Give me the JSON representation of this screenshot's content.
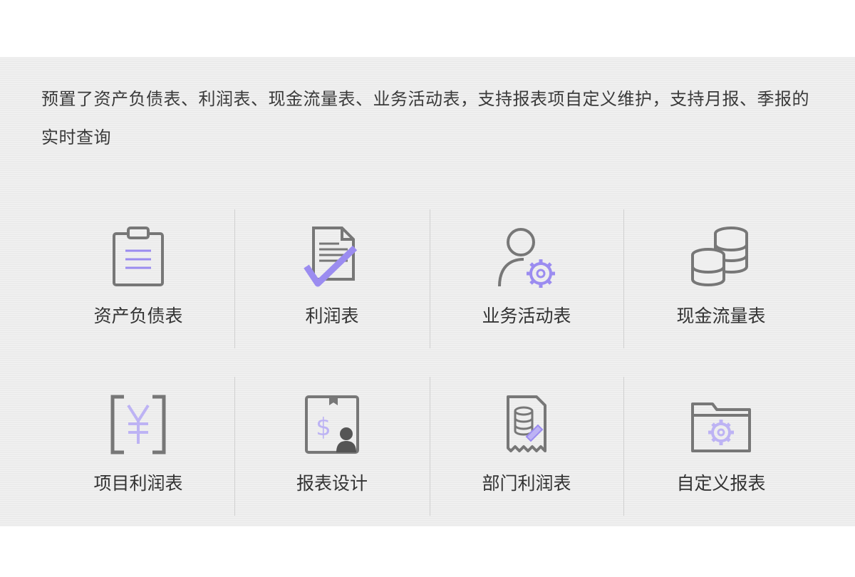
{
  "description": "预置了资产负债表、利润表、现金流量表、业务活动表，支持报表项自定义维护，支持月报、季报的实时查询",
  "tiles": [
    {
      "label": "资产负债表",
      "icon": "clipboard-icon"
    },
    {
      "label": "利润表",
      "icon": "document-check-icon"
    },
    {
      "label": "业务活动表",
      "icon": "user-gear-icon"
    },
    {
      "label": "现金流量表",
      "icon": "coins-stack-icon"
    },
    {
      "label": "项目利润表",
      "icon": "yuan-bracket-icon"
    },
    {
      "label": "报表设计",
      "icon": "dollar-user-icon"
    },
    {
      "label": "部门利润表",
      "icon": "receipt-database-icon"
    },
    {
      "label": "自定义报表",
      "icon": "folder-gear-icon"
    }
  ],
  "colors": {
    "accent": "#9b8cf0",
    "icon_gray": "#777777",
    "panel_bg": "#efefef",
    "divider": "#d0d0d0"
  }
}
